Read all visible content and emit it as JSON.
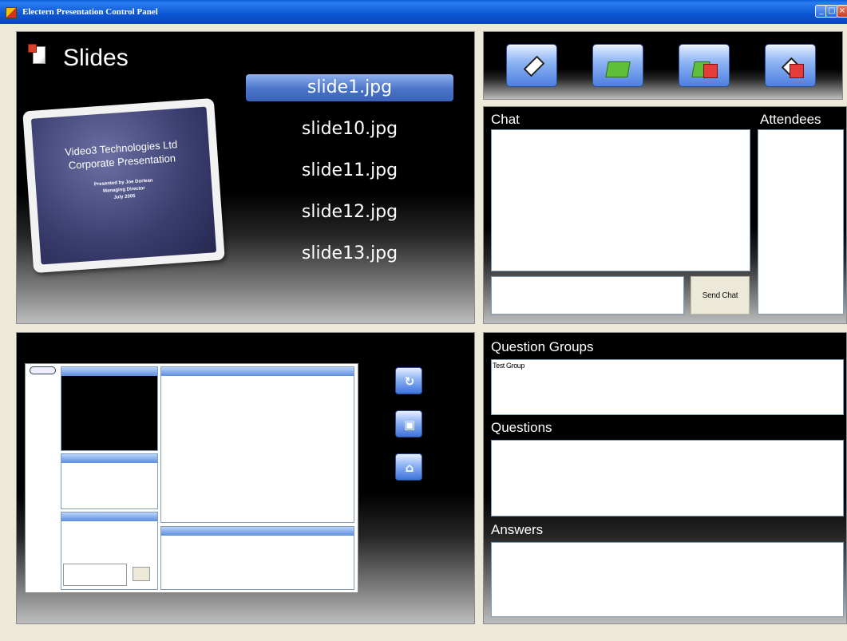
{
  "window": {
    "title": "Electern Presentation Control Panel"
  },
  "slides": {
    "title": "Slides",
    "thumbnail": {
      "heading_lines": [
        "Video3 Technologies Ltd",
        "Corporate Presentation"
      ],
      "sub_lines": [
        "Presented by Joe Dorlean",
        "Managing Director",
        "July 2005"
      ]
    },
    "files": [
      "slide1.jpg",
      "slide10.jpg",
      "slide11.jpg",
      "slide12.jpg",
      "slide13.jpg"
    ],
    "selected_index": 0
  },
  "toolbar": {
    "buttons": [
      {
        "icon": "eraser-icon"
      },
      {
        "icon": "open-folder-icon"
      },
      {
        "icon": "folder-red-box-icon"
      },
      {
        "icon": "eraser-red-box-icon"
      }
    ]
  },
  "chat": {
    "label": "Chat",
    "attendees_label": "Attendees",
    "send_button": "Send Chat",
    "input_value": ""
  },
  "questions": {
    "groups_label": "Question Groups",
    "groups": [
      "Test Group"
    ],
    "questions_label": "Questions",
    "answers_label": "Answers"
  },
  "preview_controls": {
    "buttons": [
      {
        "icon": "refresh-icon"
      },
      {
        "icon": "slide-view-icon"
      },
      {
        "icon": "home-icon"
      }
    ]
  }
}
